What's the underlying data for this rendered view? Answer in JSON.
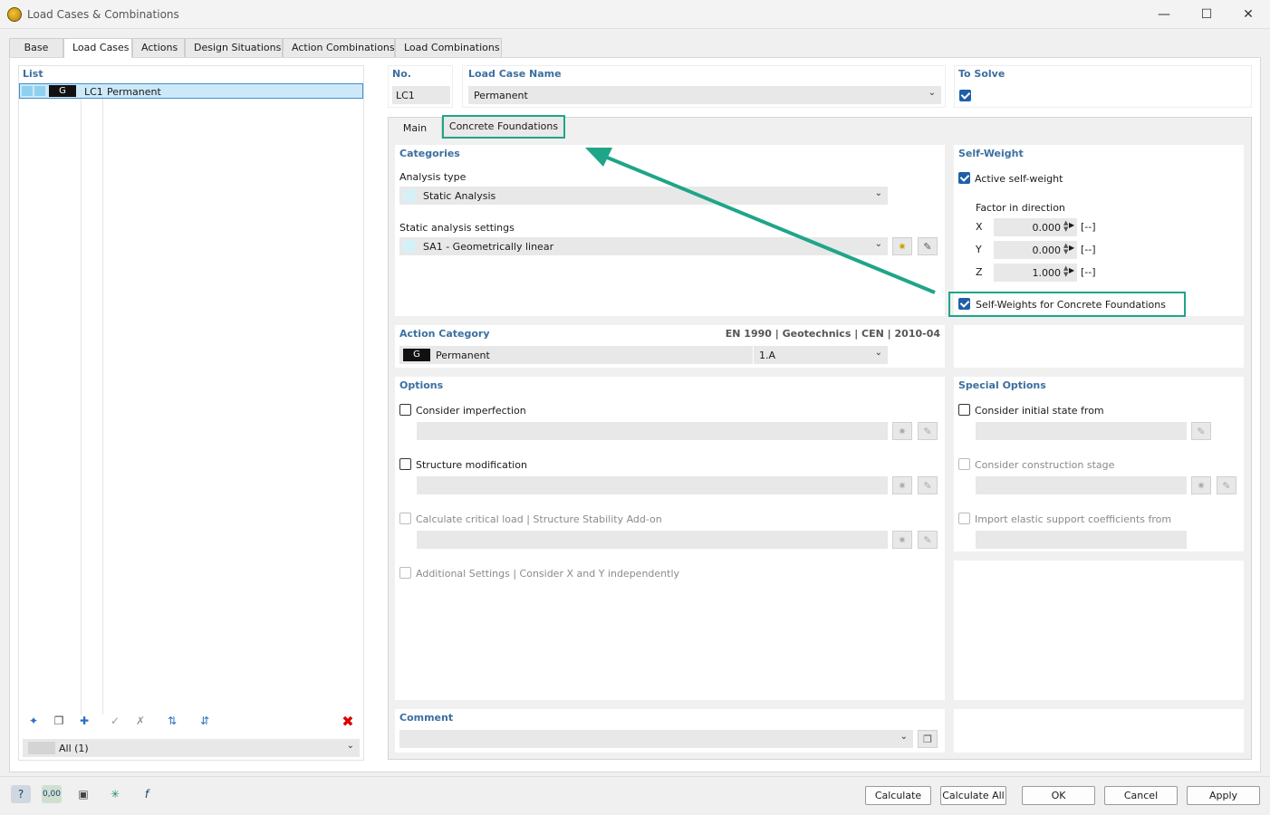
{
  "window": {
    "title": "Load Cases & Combinations"
  },
  "tabs": [
    "Base",
    "Load Cases",
    "Actions",
    "Design Situations",
    "Action Combinations",
    "Load Combinations"
  ],
  "list": {
    "header": "List",
    "items": [
      {
        "code": "G",
        "id": "LC1",
        "name": "Permanent"
      }
    ],
    "filter": "All (1)"
  },
  "header_fields": {
    "no_label": "No.",
    "no_value": "LC1",
    "name_label": "Load Case Name",
    "name_value": "Permanent",
    "to_solve_label": "To Solve"
  },
  "subtabs": [
    "Main",
    "Concrete Foundations"
  ],
  "categories": {
    "header": "Categories",
    "analysis_type_label": "Analysis type",
    "analysis_type_value": "Static Analysis",
    "static_settings_label": "Static analysis settings",
    "static_settings_value": "SA1 - Geometrically linear"
  },
  "self_weight": {
    "header": "Self-Weight",
    "active_label": "Active self-weight",
    "factor_label": "Factor in direction",
    "factors": [
      {
        "axis": "X",
        "value": "0.000",
        "unit": "[--]"
      },
      {
        "axis": "Y",
        "value": "0.000",
        "unit": "[--]"
      },
      {
        "axis": "Z",
        "value": "1.000",
        "unit": "[--]"
      }
    ],
    "concrete_label": "Self-Weights for Concrete Foundations"
  },
  "action_category": {
    "header": "Action Category",
    "standard": "EN 1990 | Geotechnics | CEN | 2010-04",
    "code": "G",
    "name": "Permanent",
    "subtype": "1.A"
  },
  "options": {
    "header": "Options",
    "imperfection": "Consider imperfection",
    "structure_mod": "Structure modification",
    "critical_load": "Calculate critical load | Structure Stability Add-on",
    "additional": "Additional Settings | Consider X and Y independently"
  },
  "special_options": {
    "header": "Special Options",
    "initial_state": "Consider initial state from",
    "construction_stage": "Consider construction stage",
    "elastic_support": "Import elastic support coefficients from"
  },
  "comment": {
    "header": "Comment"
  },
  "buttons": {
    "calculate": "Calculate",
    "calculate_all": "Calculate All",
    "ok": "OK",
    "cancel": "Cancel",
    "apply": "Apply"
  },
  "colors": {
    "accent": "#1f5fa8",
    "header": "#3b6fa0",
    "highlight": "#1fa588"
  },
  "bottom_icons": {
    "precision": "0,00"
  }
}
